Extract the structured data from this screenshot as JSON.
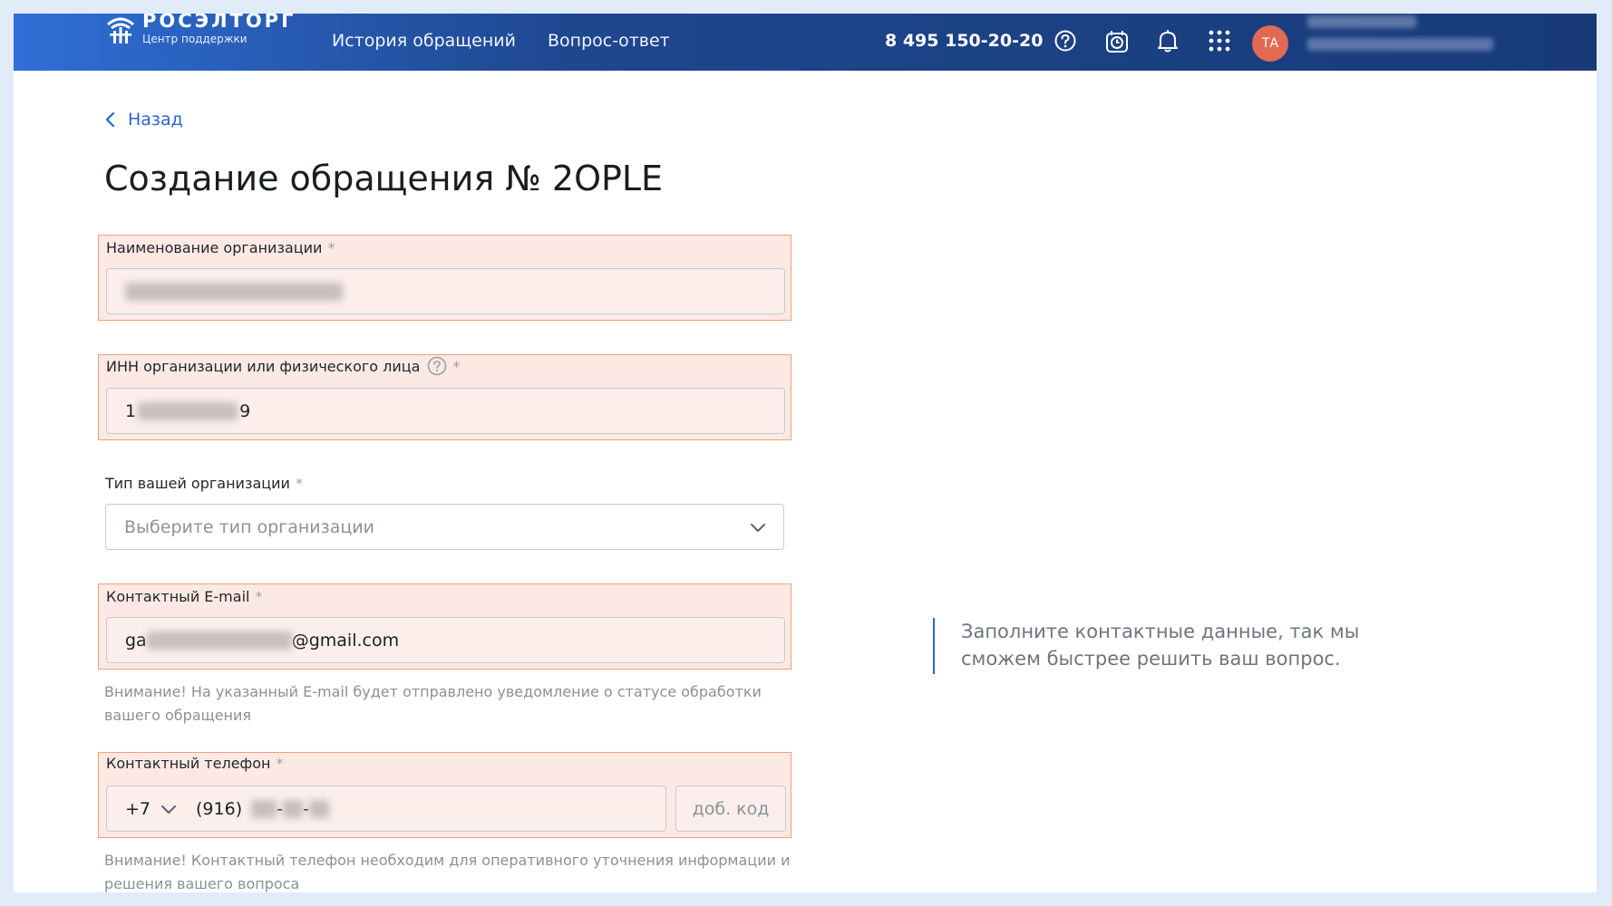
{
  "header": {
    "logo_name": "РОСЭЛТОРГ",
    "logo_sub": "Центр поддержки",
    "nav": [
      "История обращений",
      "Вопрос-ответ"
    ],
    "phone": "8 495 150-20-20",
    "avatar_initials": "ТА"
  },
  "page": {
    "back_label": "Назад",
    "title": "Создание обращения № 2OPLE"
  },
  "form": {
    "org_name": {
      "label": "Наименование организации",
      "required": "*"
    },
    "inn": {
      "label": "ИНН организации или физического лица",
      "required": "*",
      "value_start": "1",
      "value_end": "9"
    },
    "org_type": {
      "label": "Тип вашей организации",
      "required": "*",
      "placeholder": "Выберите тип организации"
    },
    "email": {
      "label": "Контактный E-mail",
      "required": "*",
      "value_start": "ga",
      "value_end": "@gmail.com",
      "hint": "Внимание! На указанный E-mail будет отправлено уведомление о статусе обработки вашего обращения"
    },
    "phone": {
      "label": "Контактный телефон",
      "required": "*",
      "country_code": "+7",
      "area_code": "(916)",
      "separator": "-",
      "ext_placeholder": "доб. код",
      "hint": "Внимание! Контактный телефон необходим для оперативного уточнения информации и решения вашего вопроса"
    }
  },
  "side_note": "Заполните контактные данные, так мы сможем быстрее решить ваш вопрос.",
  "colors": {
    "accent": "#2d63d0",
    "error_border": "#f0a07a",
    "error_bg": "#fde9e4",
    "header": "#183a78",
    "avatar": "#e06a53"
  }
}
